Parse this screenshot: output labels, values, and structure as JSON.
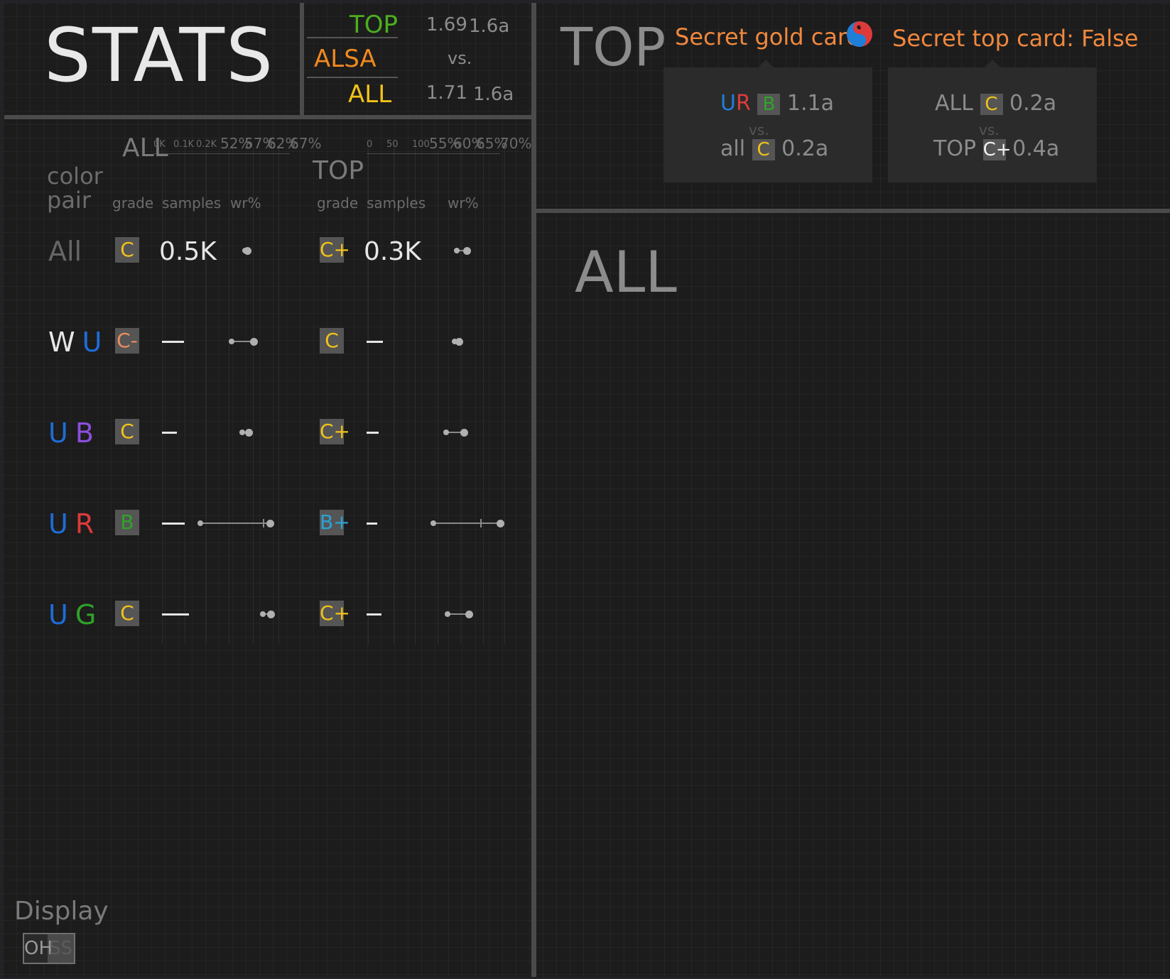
{
  "stats_panel": {
    "title": "STATS",
    "comparison": {
      "top_label": "TOP",
      "alsa_label": "ALSA",
      "vs": "vs.",
      "all_label": "ALL",
      "top_val1": "1.69",
      "top_val2": "1.6a",
      "all_val1": "1.71",
      "all_val2": "1.6a",
      "colors": {
        "top": "#4caf1f",
        "alsa": "#f0881e",
        "all": "#f2c318"
      }
    },
    "table": {
      "color_pair_header": [
        "color",
        "pair"
      ],
      "groups": [
        {
          "label": "ALL",
          "axis_samples": [
            "0K",
            "0.1K",
            "0.2K"
          ],
          "axis_wr": [
            "52%",
            "57%",
            "62%",
            "67%"
          ]
        },
        {
          "label": "TOP",
          "axis_samples": [
            "0",
            "50",
            "100"
          ],
          "axis_wr": [
            "55%",
            "60%",
            "65%",
            "70%"
          ]
        }
      ],
      "col_headers": {
        "grade": "grade",
        "samples": "samples",
        "wr": "wr%"
      },
      "rows": [
        {
          "pair": [
            {
              "text": "All",
              "color": "#666666"
            }
          ],
          "all": {
            "grade": "C",
            "grade_color": "#f2c318",
            "samples_text": "0.5K",
            "samples_frac": 0,
            "wr": {
              "a": 0.37,
              "b": 0.4
            }
          },
          "top": {
            "grade": "C+",
            "grade_color": "#f2c318",
            "samples_text": "0.3K",
            "samples_frac": 0,
            "wr": {
              "a": 0.33,
              "b": 0.47
            }
          }
        },
        {
          "pair": [
            {
              "text": "W",
              "color": "#e6e6e6"
            },
            {
              "text": "U",
              "color": "#1e6cd8"
            }
          ],
          "all": {
            "grade": "C-",
            "grade_color": "#ef8d5c",
            "samples_text": "",
            "samples_frac": 0.5,
            "wr": {
              "a": 0.2,
              "b": 0.48
            }
          },
          "top": {
            "grade": "C",
            "grade_color": "#f2c318",
            "samples_text": "",
            "samples_frac": 0.45,
            "wr": {
              "a": 0.3,
              "b": 0.36
            }
          }
        },
        {
          "pair": [
            {
              "text": "U",
              "color": "#1e6cd8"
            },
            {
              "text": "B",
              "color": "#8a4fdd"
            }
          ],
          "all": {
            "grade": "C",
            "grade_color": "#f2c318",
            "samples_text": "",
            "samples_frac": 0.34,
            "wr": {
              "a": 0.34,
              "b": 0.42
            }
          },
          "top": {
            "grade": "C+",
            "grade_color": "#f2c318",
            "samples_text": "",
            "samples_frac": 0.34,
            "wr": {
              "a": 0.18,
              "b": 0.43
            }
          }
        },
        {
          "pair": [
            {
              "text": "U",
              "color": "#1e6cd8"
            },
            {
              "text": "R",
              "color": "#dd3a3a"
            }
          ],
          "all": {
            "grade": "B",
            "grade_color": "#2fa32a",
            "samples_text": "",
            "samples_frac": 0.52,
            "wr": {
              "a": -0.2,
              "b": 0.69
            },
            "median": 0.6
          },
          "top": {
            "grade": "B+",
            "grade_color": "#2aa3d6",
            "samples_text": "",
            "samples_frac": 0.3,
            "wr": {
              "a": 0.0,
              "b": 0.94
            },
            "median": 0.66
          }
        },
        {
          "pair": [
            {
              "text": "U",
              "color": "#1e6cd8"
            },
            {
              "text": "G",
              "color": "#2fa32a"
            }
          ],
          "all": {
            "grade": "C",
            "grade_color": "#f2c318",
            "samples_text": "",
            "samples_frac": 0.62,
            "wr": {
              "a": 0.6,
              "b": 0.7
            }
          },
          "top": {
            "grade": "C+",
            "grade_color": "#f2c318",
            "samples_text": "",
            "samples_frac": 0.41,
            "wr": {
              "a": 0.2,
              "b": 0.5
            }
          }
        }
      ]
    },
    "display": {
      "label": "Display",
      "toggle_on": "OH",
      "toggle_off": "SS"
    }
  },
  "top_panel": {
    "title": "TOP",
    "secret_gold_label": "Secret gold card:",
    "secret_top_label": "Secret top card: False",
    "gold_popup": {
      "line1": {
        "pair_a": "U",
        "pair_b": "R",
        "grade": "B",
        "grade_color": "#2fa32a",
        "value": "1.1a"
      },
      "vs": "vs.",
      "line2": {
        "label": "all",
        "grade": "C",
        "grade_color": "#f2c318",
        "value": "0.2a"
      }
    },
    "top_popup": {
      "line1": {
        "label": "ALL",
        "grade": "C",
        "grade_color": "#f2c318",
        "value": "0.2a"
      },
      "vs": "vs.",
      "line2": {
        "label": "TOP",
        "grade": "C+",
        "grade_color": "#f2f2f2",
        "value": "0.4a"
      }
    }
  },
  "all_panel": {
    "title": "ALL"
  }
}
